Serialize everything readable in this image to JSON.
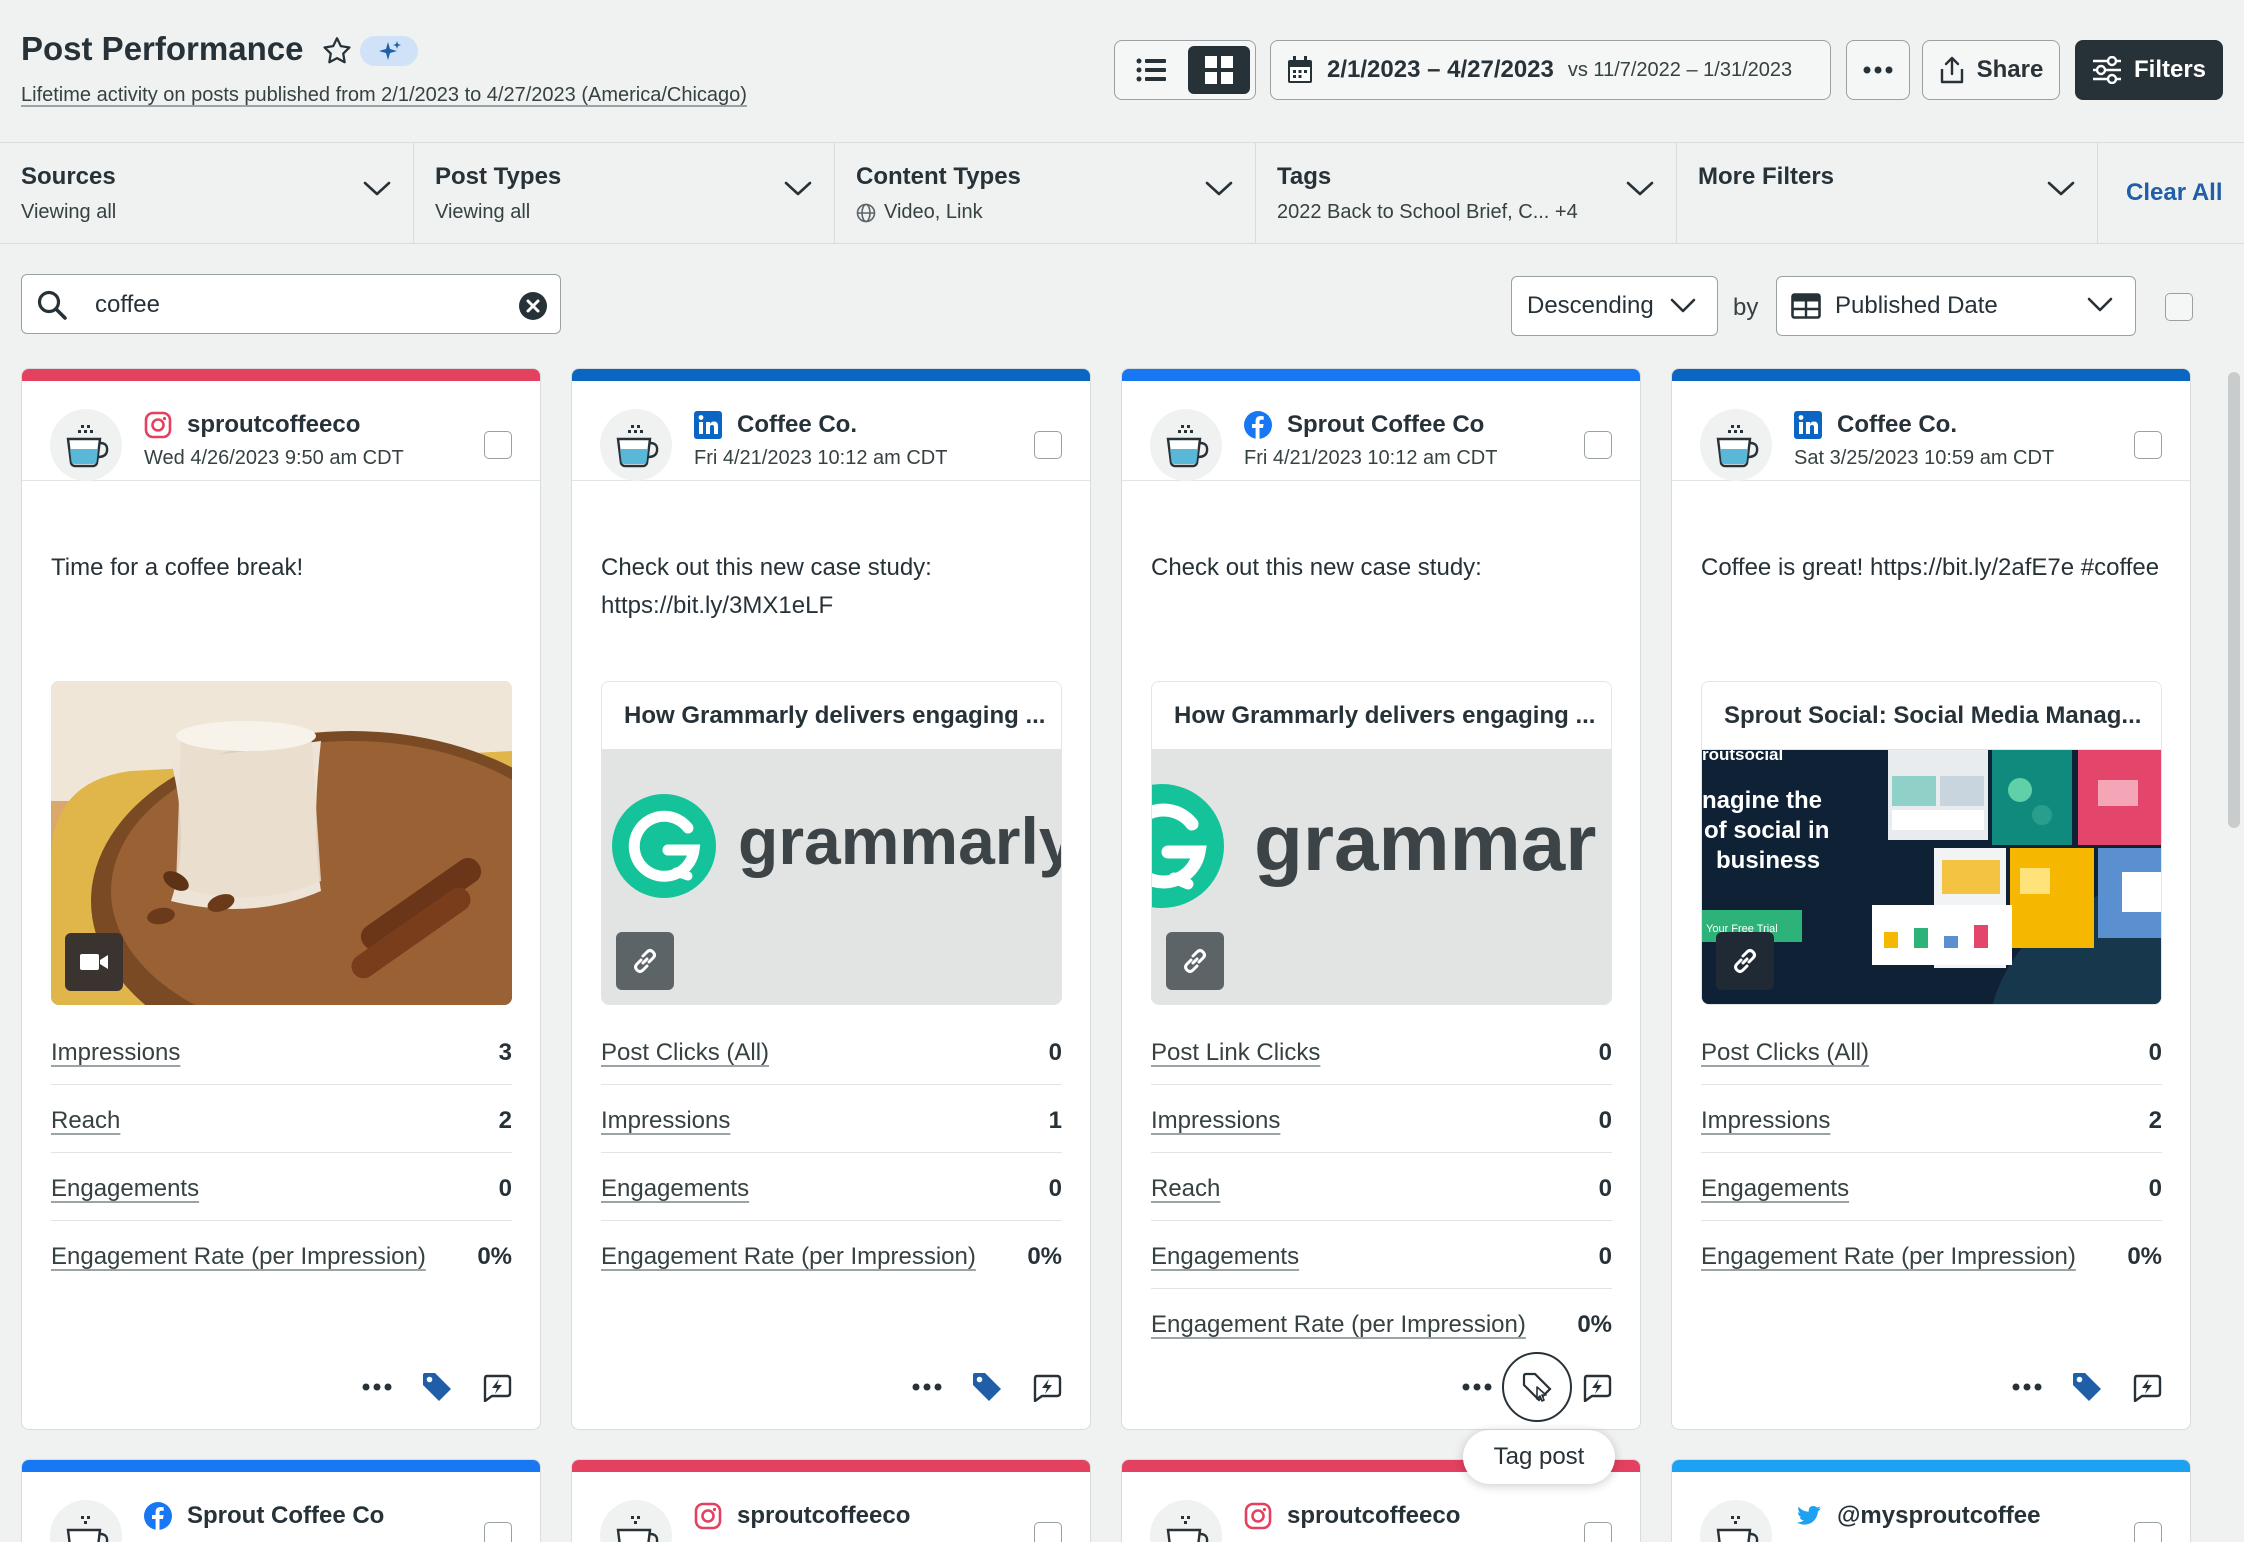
{
  "header": {
    "title": "Post Performance",
    "subtitle": "Lifetime activity on posts published from 2/1/2023 to 4/27/2023 (America/Chicago)",
    "date_range": "2/1/2023 – 4/27/2023",
    "compare_label": "vs 11/7/2022 – 1/31/2023",
    "share_label": "Share",
    "filters_label": "Filters"
  },
  "filters": [
    {
      "label": "Sources",
      "value": "Viewing all"
    },
    {
      "label": "Post Types",
      "value": "Viewing all"
    },
    {
      "label": "Content Types",
      "value": "Video, Link"
    },
    {
      "label": "Tags",
      "value": "2022 Back to School Brief, C... +4"
    },
    {
      "label": "More Filters",
      "value": ""
    }
  ],
  "clear_all_label": "Clear All",
  "search": {
    "value": "coffee"
  },
  "sort": {
    "order": "Descending",
    "by_label": "by",
    "field": "Published Date"
  },
  "colors": {
    "instagram": "#e4405f",
    "linkedin": "#0a66c2",
    "facebook": "#1877f2",
    "twitter": "#1da1f2",
    "tag": "#205ea8"
  },
  "cards": [
    {
      "network": "instagram-icon",
      "account": "sproutcoffeeco",
      "date": "Wed 4/26/2023 9:50 am CDT",
      "text": "Time for a coffee break!",
      "media_badge": "video-icon",
      "metrics": [
        {
          "label": "Impressions",
          "value": "3"
        },
        {
          "label": "Reach",
          "value": "2"
        },
        {
          "label": "Engagements",
          "value": "0"
        },
        {
          "label": "Engagement Rate (per Impression)",
          "value": "0%"
        }
      ]
    },
    {
      "network": "linkedin-icon",
      "account": "Coffee Co.",
      "date": "Fri 4/21/2023 10:12 am CDT",
      "text": "Check out this new case study: https://bit.ly/3MX1eLF",
      "link_title": "How Grammarly delivers engaging ...",
      "link_brand": "grammarly",
      "metrics": [
        {
          "label": "Post Clicks (All)",
          "value": "0"
        },
        {
          "label": "Impressions",
          "value": "1"
        },
        {
          "label": "Engagements",
          "value": "0"
        },
        {
          "label": "Engagement Rate (per Impression)",
          "value": "0%"
        }
      ]
    },
    {
      "network": "facebook-icon",
      "account": "Sprout Coffee Co",
      "date": "Fri 4/21/2023 10:12 am CDT",
      "text": "Check out this new case study:",
      "link_title": "How Grammarly delivers engaging ...",
      "link_brand": "grammar",
      "metrics": [
        {
          "label": "Post Link Clicks",
          "value": "0"
        },
        {
          "label": "Impressions",
          "value": "0"
        },
        {
          "label": "Reach",
          "value": "0"
        },
        {
          "label": "Engagements",
          "value": "0"
        },
        {
          "label": "Engagement Rate (per Impression)",
          "value": "0%"
        }
      ]
    },
    {
      "network": "linkedin-icon",
      "account": "Coffee Co.",
      "date": "Sat 3/25/2023 10:59 am CDT",
      "text": "Coffee is great! https://bit.ly/2afE7e #coffee",
      "link_title": "Sprout Social: Social Media Manag...",
      "link_preview_text": [
        "routsocial",
        "nagine the",
        "of social in",
        "business",
        "Your Free Trial"
      ],
      "metrics": [
        {
          "label": "Post Clicks (All)",
          "value": "0"
        },
        {
          "label": "Impressions",
          "value": "2"
        },
        {
          "label": "Engagements",
          "value": "0"
        },
        {
          "label": "Engagement Rate (per Impression)",
          "value": "0%"
        }
      ]
    }
  ],
  "next_row": [
    {
      "network": "facebook-icon",
      "account": "Sprout Coffee Co"
    },
    {
      "network": "instagram-icon",
      "account": "sproutcoffeeco"
    },
    {
      "network": "instagram-icon",
      "account": "sproutcoffeeco"
    },
    {
      "network": "twitter-icon",
      "account": "@mysproutcoffee"
    }
  ],
  "tooltip": "Tag post"
}
